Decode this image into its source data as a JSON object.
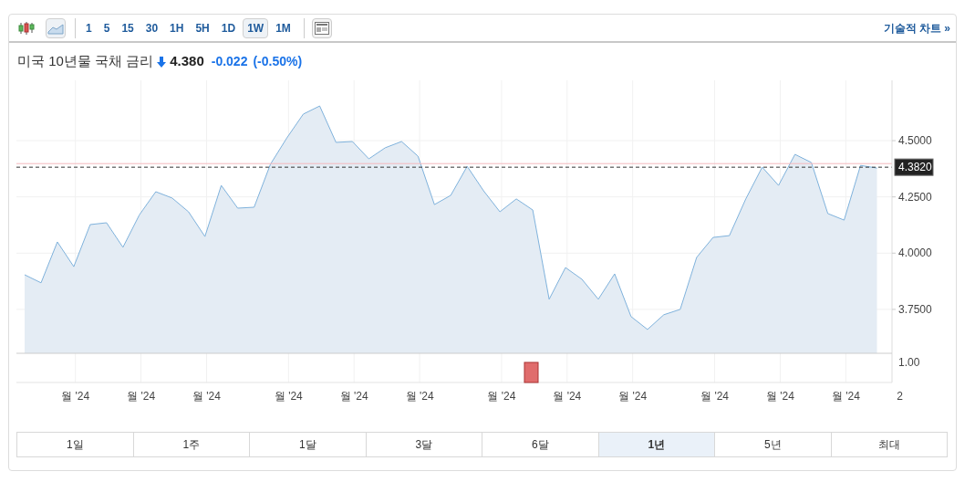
{
  "toolbar": {
    "chart_types": [
      {
        "kind": "candles",
        "selected": false
      },
      {
        "kind": "area",
        "selected": true
      }
    ],
    "intervals": [
      {
        "label": "1",
        "selected": false
      },
      {
        "label": "5",
        "selected": false
      },
      {
        "label": "15",
        "selected": false
      },
      {
        "label": "30",
        "selected": false
      },
      {
        "label": "1H",
        "selected": false
      },
      {
        "label": "5H",
        "selected": false
      },
      {
        "label": "1D",
        "selected": false
      },
      {
        "label": "1W",
        "selected": true
      },
      {
        "label": "1M",
        "selected": false
      }
    ],
    "link": "기술적 차트 »"
  },
  "quote": {
    "name": "미국 10년물 국채 금리",
    "falling": true,
    "price": "4.380",
    "change": "-0.022",
    "change_percent": "(-0.50%)"
  },
  "chart": {
    "volume_label": "1.00",
    "x_axis_labels": [
      "월 '24",
      "월 '24",
      "월 '24",
      "월 '24",
      "월 '24",
      "월 '24",
      "월 '24",
      "월 '24",
      "월 '24",
      "월 '24",
      "월 '24",
      "월 '24",
      "2"
    ],
    "chart_data": {
      "type": "area",
      "grid": true,
      "categories": [
        null,
        null,
        null,
        null,
        null,
        null,
        null,
        null,
        null,
        null,
        null,
        null,
        null,
        null,
        null,
        null,
        null,
        null,
        null,
        null,
        null,
        null,
        null,
        null,
        null,
        null,
        null,
        null,
        null,
        null,
        null,
        null,
        null,
        null,
        null,
        null,
        null,
        null,
        null,
        null,
        null,
        null,
        null,
        null,
        null,
        null,
        null,
        null,
        null,
        null,
        null,
        null,
        null
      ],
      "series": [
        {
          "color": "#7fb2dc",
          "values": [
            3.904,
            3.868,
            4.05,
            3.94,
            4.127,
            4.135,
            4.026,
            4.17,
            4.273,
            4.245,
            4.184,
            4.074,
            4.301,
            4.2,
            4.204,
            4.395,
            4.512,
            4.618,
            4.654,
            4.492,
            4.496,
            4.419,
            4.468,
            4.496,
            4.431,
            4.216,
            4.257,
            4.386,
            4.277,
            4.184,
            4.241,
            4.192,
            3.795,
            3.936,
            3.884,
            3.795,
            3.908,
            3.718,
            3.661,
            3.726,
            3.75,
            3.981,
            4.07,
            4.078,
            4.241,
            4.382,
            4.301,
            4.439,
            4.403,
            4.176,
            4.147,
            4.39,
            4.378
          ]
        }
      ],
      "ylim": [
        3.555,
        4.768
      ],
      "yticks": [
        {
          "value": 3.75,
          "label": "3.7500"
        },
        {
          "value": 4.0,
          "label": "4.0000"
        },
        {
          "value": 4.25,
          "label": "4.2500"
        },
        {
          "value": 4.5,
          "label": "4.5000"
        }
      ],
      "ref_lines": [
        {
          "axis": "y",
          "value": 4.398,
          "color": "#f4b8bd"
        },
        {
          "axis": "y",
          "value": 4.382,
          "color": "#333333",
          "label": "4.3820"
        }
      ]
    }
  },
  "ranges": [
    {
      "label": "1일",
      "selected": false
    },
    {
      "label": "1주",
      "selected": false
    },
    {
      "label": "1달",
      "selected": false
    },
    {
      "label": "3달",
      "selected": false
    },
    {
      "label": "6달",
      "selected": false
    },
    {
      "label": "1년",
      "selected": true
    },
    {
      "label": "5년",
      "selected": false
    },
    {
      "label": "최대",
      "selected": false
    }
  ]
}
